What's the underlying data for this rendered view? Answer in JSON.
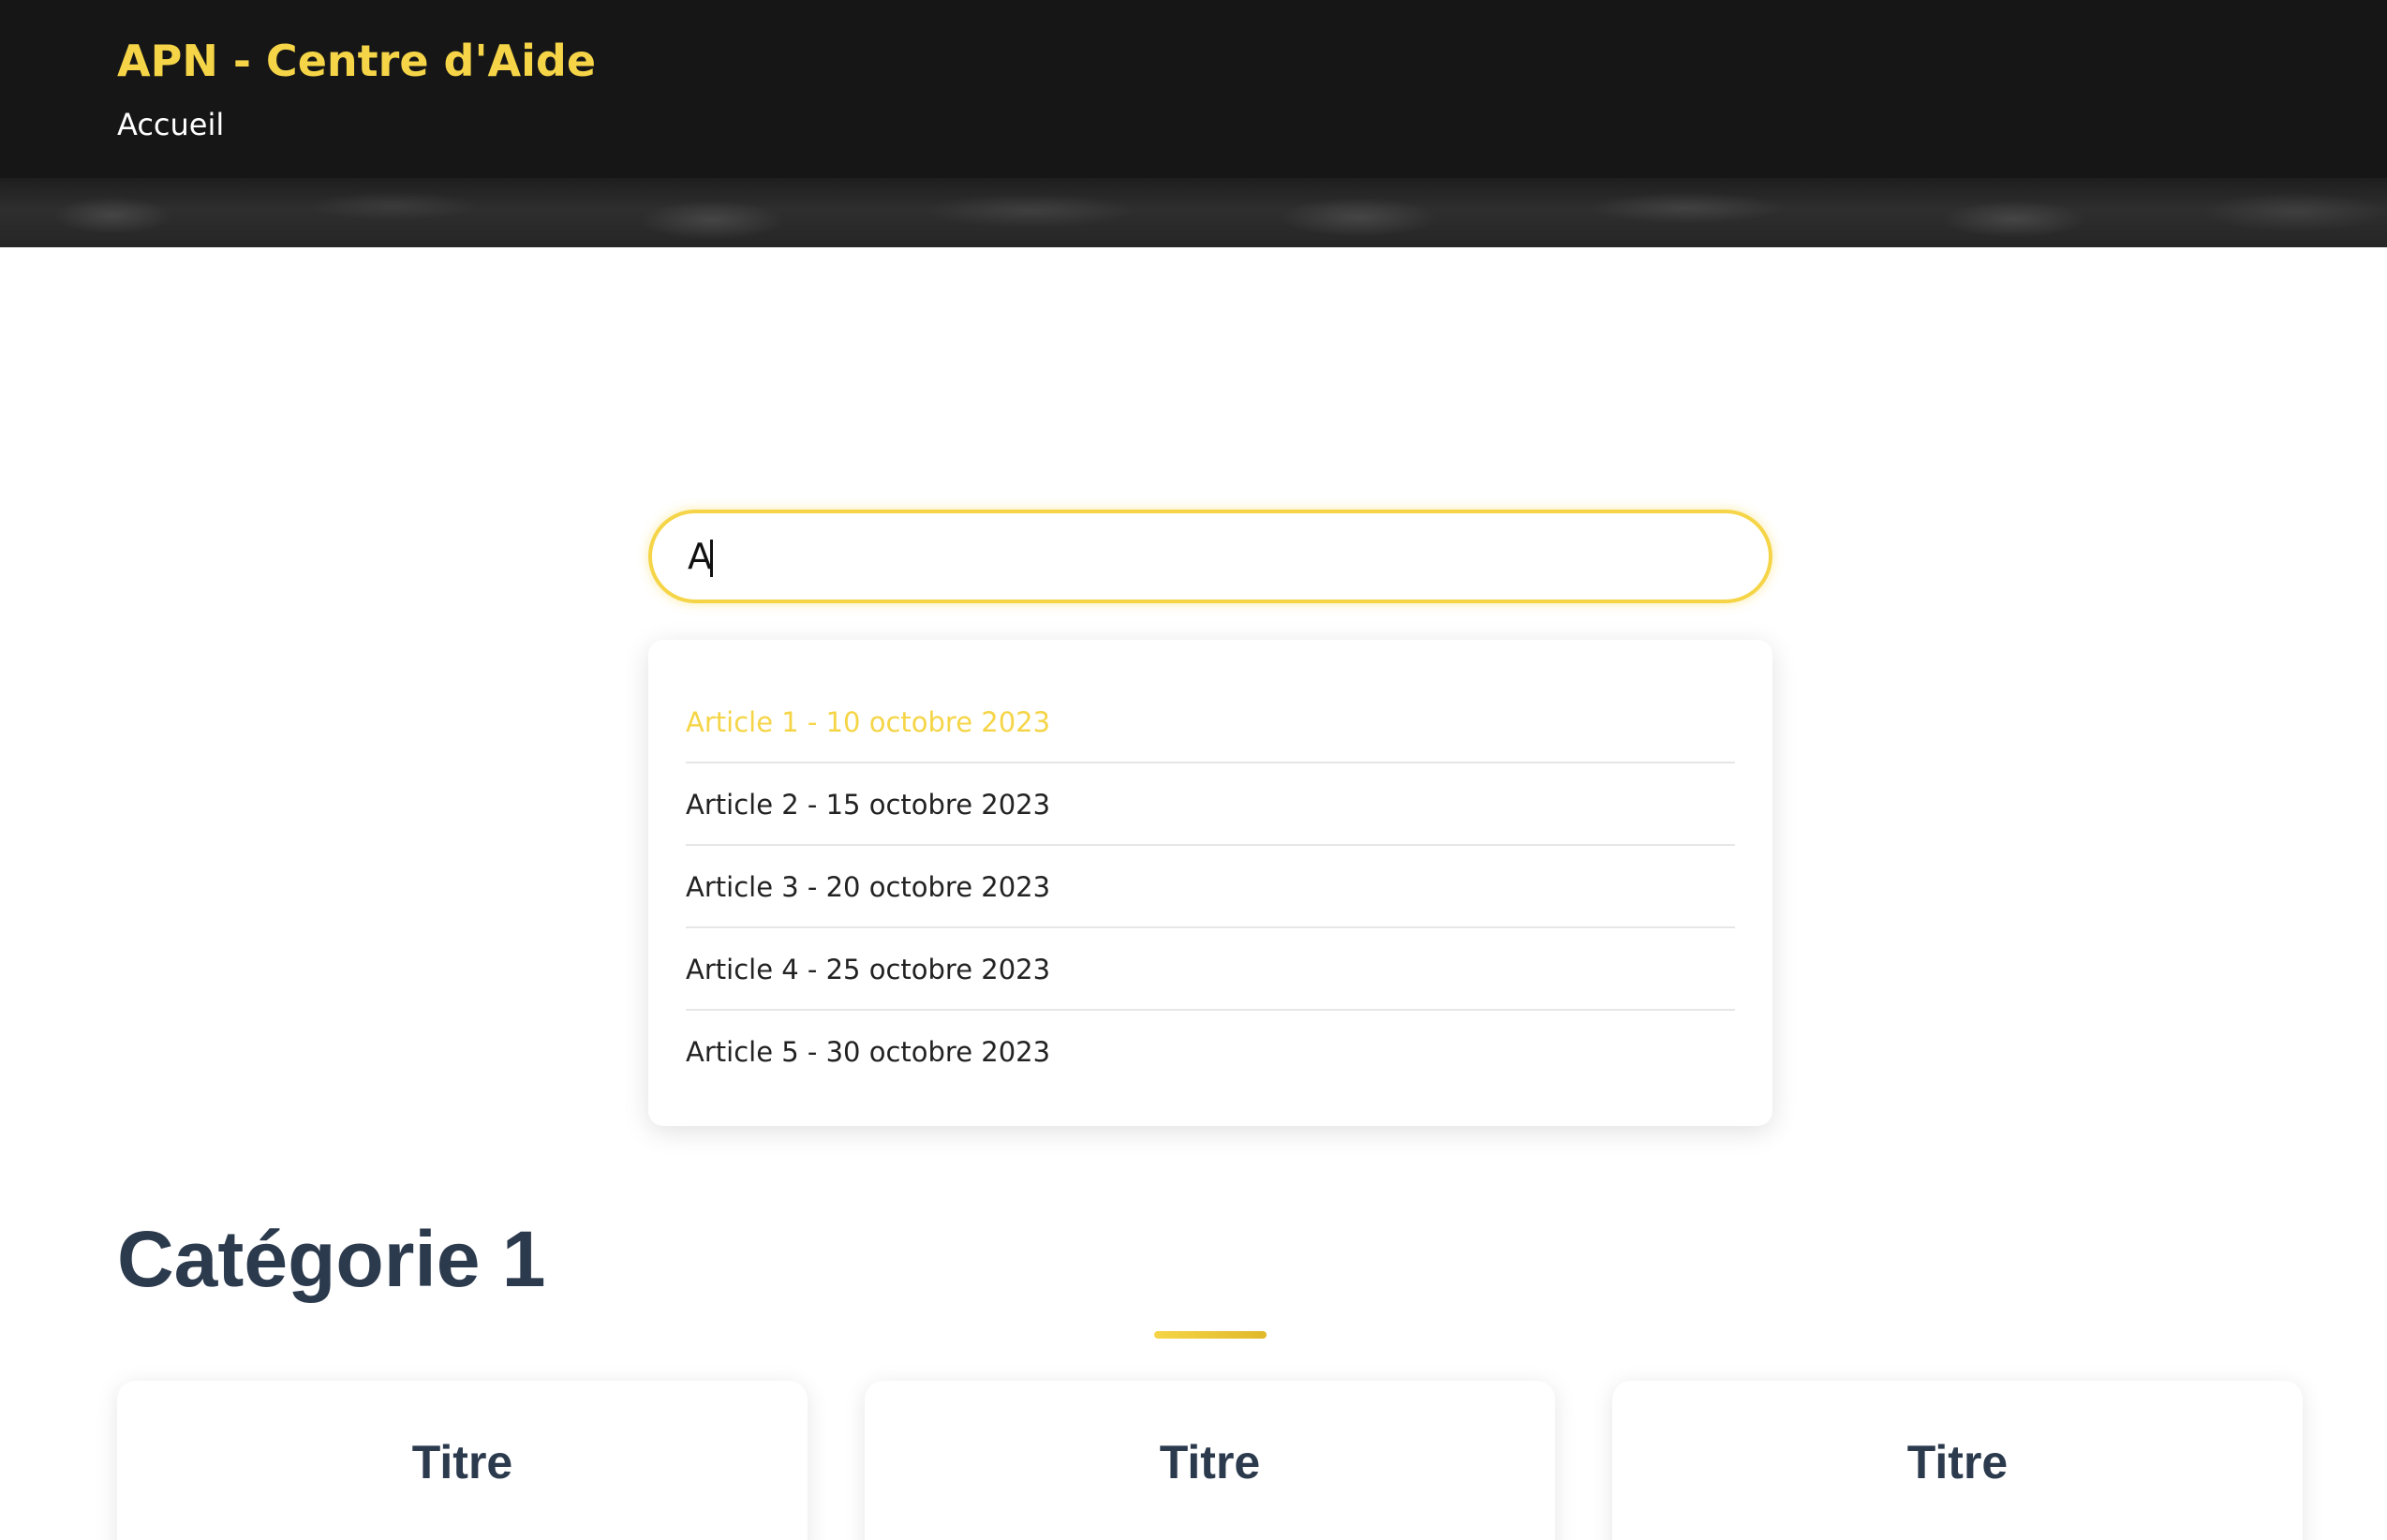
{
  "header": {
    "site_title": "APN - Centre d'Aide",
    "nav_home": "Accueil"
  },
  "search": {
    "value": "A",
    "results": [
      "Article 1 - 10 octobre 2023",
      "Article 2 - 15 octobre 2023",
      "Article 3 - 20 octobre 2023",
      "Article 4 - 25 octobre 2023",
      "Article 5 - 30 octobre 2023"
    ]
  },
  "category": {
    "title": "Catégorie 1",
    "cards": [
      "Titre",
      "Titre",
      "Titre"
    ]
  },
  "colors": {
    "accent": "#f5d547",
    "header_bg": "#161616",
    "heading": "#2c3a4d"
  }
}
